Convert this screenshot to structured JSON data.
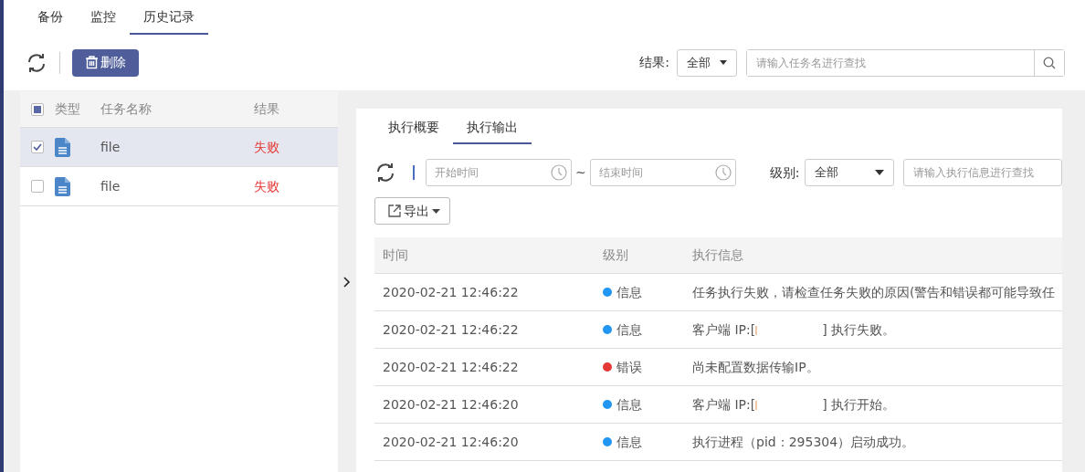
{
  "tabs": [
    {
      "label": "备份",
      "selected": false
    },
    {
      "label": "监控",
      "selected": false
    },
    {
      "label": "历史记录",
      "selected": true
    }
  ],
  "toolbar": {
    "delete_button": "删除",
    "result_filter": {
      "label": "结果:",
      "value": "全部"
    },
    "search": {
      "placeholder": "请输入任务名进行查找"
    }
  },
  "task_table": {
    "select_all": {
      "indeterminate": true
    },
    "columns": [
      "类型",
      "任务名称",
      "结果"
    ],
    "rows": [
      {
        "name": "file",
        "result": "失败",
        "checked": true,
        "selected": true
      },
      {
        "name": "file",
        "result": "失败",
        "checked": false,
        "selected": false
      }
    ]
  },
  "detail": {
    "tabs": [
      {
        "label": "执行概要",
        "selected": false
      },
      {
        "label": "执行输出",
        "selected": true
      }
    ],
    "start_time": {
      "placeholder": "开始时间"
    },
    "separator": "~",
    "end_time": {
      "placeholder": "结束时间"
    },
    "level_filter": {
      "label": "级别:",
      "value": "全部"
    },
    "search": {
      "placeholder": "请输入执行信息进行查找"
    },
    "export_button": "导出",
    "log_table": {
      "columns": [
        "时间",
        "级别",
        "执行信息"
      ],
      "rows": [
        {
          "time": "2020-02-21 12:46:22",
          "level": "信息",
          "color": "#2196f3",
          "message": "任务执行失败，请检查任务失败的原因(警告和错误都可能导致任"
        },
        {
          "time": "2020-02-21 12:46:22",
          "level": "信息",
          "color": "#2196f3",
          "message": "客户端 IP:[",
          "redacted": true,
          "message_end": "] 执行失败。"
        },
        {
          "time": "2020-02-21 12:46:22",
          "level": "错误",
          "color": "#e53935",
          "message": "尚未配置数据传输IP。"
        },
        {
          "time": "2020-02-21 12:46:20",
          "level": "信息",
          "color": "#2196f3",
          "message": "客户端 IP:[",
          "redacted": true,
          "message_end": "] 执行开始。"
        },
        {
          "time": "2020-02-21 12:46:20",
          "level": "信息",
          "color": "#2196f3",
          "message": "执行进程（pid：295304）启动成功。"
        }
      ]
    }
  }
}
